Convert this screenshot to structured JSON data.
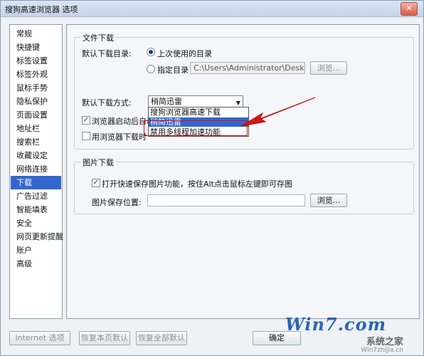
{
  "window": {
    "title": "搜狗高速浏览器 选项",
    "close_glyph": "✕"
  },
  "sidebar": {
    "items": [
      {
        "label": "常规"
      },
      {
        "label": "快捷键"
      },
      {
        "label": "标签设置"
      },
      {
        "label": "标签外观"
      },
      {
        "label": "鼠标手势"
      },
      {
        "label": "隐私保护"
      },
      {
        "label": "页面设置"
      },
      {
        "label": "地址栏"
      },
      {
        "label": "搜索栏"
      },
      {
        "label": "收藏设定"
      },
      {
        "label": "网络连接"
      },
      {
        "label": "下载"
      },
      {
        "label": "广告过滤"
      },
      {
        "label": "智能填表"
      },
      {
        "label": "安全"
      },
      {
        "label": "网页更新提醒"
      },
      {
        "label": "账户"
      },
      {
        "label": "高级"
      }
    ],
    "active_label": "下载"
  },
  "file_download": {
    "legend": "文件下载",
    "default_dir_label": "默认下载目录:",
    "radio_last_used": "上次使用的目录",
    "radio_specified": "指定目录",
    "path_value": "C:\\Users\\Administrator\\Desktop",
    "browse_label": "浏览...",
    "method_label": "默认下载方式:",
    "method_selected": "稍简迅雷",
    "method_options": [
      "搜狗浏览器高速下载",
      "稍简迅雷",
      "禁用多线程加速功能"
    ],
    "check_startup": "浏览器启动后自动",
    "check_startup_tail": "止",
    "check_use_browser": "用浏览器下载时",
    "check_startup_checked": true,
    "check_use_browser_checked": false
  },
  "image_download": {
    "legend": "图片下载",
    "check_quick_save": "打开快速保存图片功能，按住Alt点击鼠标左键即可存图",
    "check_quick_save_checked": true,
    "save_location_label": "图片保存位置:",
    "save_location_value": "",
    "browse_label": "浏览..."
  },
  "footer": {
    "internet_options": "Internet 选项",
    "restore_page": "恢复本页默认",
    "restore_all": "恢复全部默认",
    "ok": "确定"
  },
  "watermark": {
    "logo": "Win7.com",
    "site": "系统之家",
    "url": "Win7zhijia.cn"
  }
}
